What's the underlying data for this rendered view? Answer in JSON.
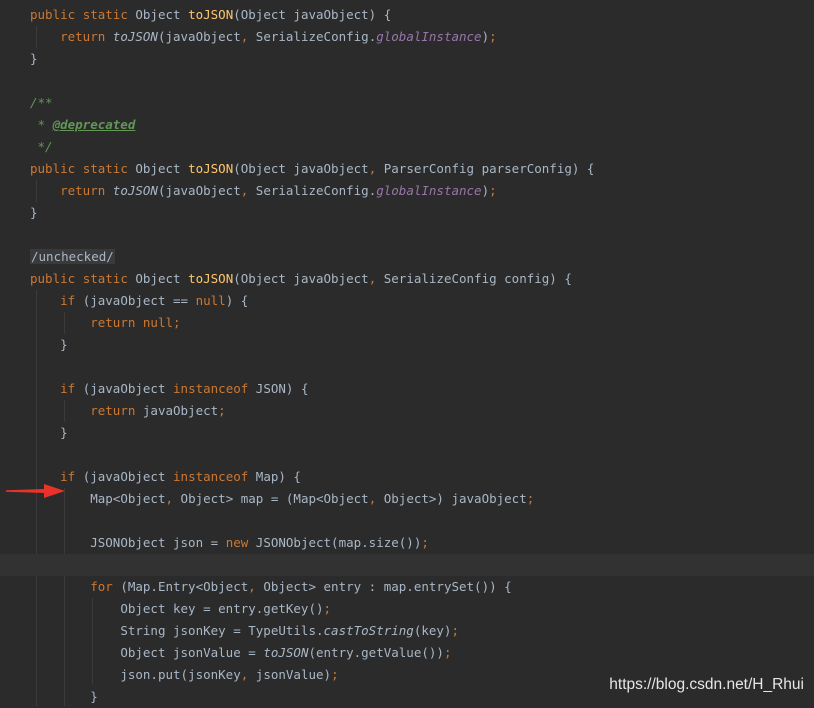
{
  "editor": {
    "theme_colors": {
      "background": "#2b2b2b",
      "keyword": "#cc7832",
      "method_decl": "#ffc66d",
      "static_field": "#9876aa",
      "doc_comment": "#629755",
      "text": "#a9b7c6",
      "arrow": "#e8322a"
    },
    "highlighted_line": 25
  },
  "watermark": {
    "text": "https://blog.csdn.net/H_Rhui"
  },
  "annotation": {
    "icon": "red-arrow-icon"
  },
  "tokens": {
    "public": "public",
    "static": "static",
    "return": "return",
    "if": "if",
    "for": "for",
    "null": "null",
    "new": "new",
    "instanceof": "instanceof",
    "semi": ";",
    "comma": ",",
    "toJSON": "toJSON",
    "globalInstance": "globalInstance",
    "castToString": "castToString",
    "L1a": " Object ",
    "L1b": "(Object javaObject) {",
    "L2a": "(javaObject",
    "L2b": " SerializeConfig.",
    "brace_close": "}",
    "doc_open": "/**",
    "doc_star": " * ",
    "doc_tag": "@deprecated",
    "doc_close": " */",
    "L7b": "(Object javaObject",
    "L7c": " ParserConfig parserConfig) {",
    "unchecked": "/unchecked/",
    "L13c": " SerializeConfig config) {",
    "L14a": " (javaObject == ",
    "L14b": ") {",
    "L15a": " ",
    "L18a": " (javaObject ",
    "L18b": " JSON) {",
    "L19a": " javaObject",
    "L22b": " Map) {",
    "L23a": "Map<Object",
    "L23b": " Object> map = (Map<Object",
    "L23c": " Object>) javaObject",
    "L25a": "JSONObject json = ",
    "L25b": " JSONObject(map.size())",
    "L27a": " (Map.Entry<Object",
    "L27b": " Object> entry : map.entrySet()) {",
    "L28": "Object key = entry.getKey()",
    "L29a": "String jsonKey = TypeUtils.",
    "L29b": "(key)",
    "L30a": "Object jsonValue = ",
    "L30b": "(entry.getValue())",
    "L31a": "json.put(jsonKey",
    "L31b": " jsonValue)"
  }
}
